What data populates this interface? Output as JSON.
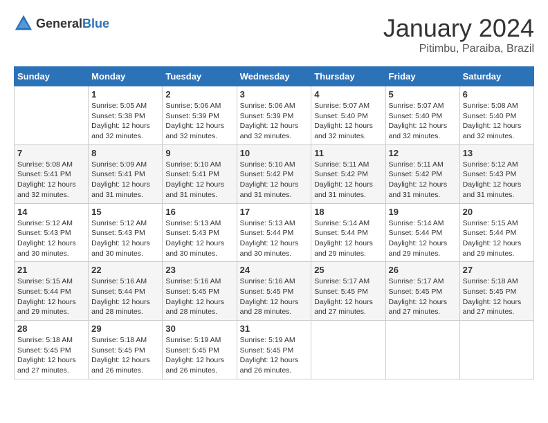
{
  "header": {
    "logo": {
      "general": "General",
      "blue": "Blue"
    },
    "title": "January 2024",
    "subtitle": "Pitimbu, Paraiba, Brazil"
  },
  "calendar": {
    "days_of_week": [
      "Sunday",
      "Monday",
      "Tuesday",
      "Wednesday",
      "Thursday",
      "Friday",
      "Saturday"
    ],
    "weeks": [
      [
        {
          "day": "",
          "info": ""
        },
        {
          "day": "1",
          "info": "Sunrise: 5:05 AM\nSunset: 5:38 PM\nDaylight: 12 hours\nand 32 minutes."
        },
        {
          "day": "2",
          "info": "Sunrise: 5:06 AM\nSunset: 5:39 PM\nDaylight: 12 hours\nand 32 minutes."
        },
        {
          "day": "3",
          "info": "Sunrise: 5:06 AM\nSunset: 5:39 PM\nDaylight: 12 hours\nand 32 minutes."
        },
        {
          "day": "4",
          "info": "Sunrise: 5:07 AM\nSunset: 5:40 PM\nDaylight: 12 hours\nand 32 minutes."
        },
        {
          "day": "5",
          "info": "Sunrise: 5:07 AM\nSunset: 5:40 PM\nDaylight: 12 hours\nand 32 minutes."
        },
        {
          "day": "6",
          "info": "Sunrise: 5:08 AM\nSunset: 5:40 PM\nDaylight: 12 hours\nand 32 minutes."
        }
      ],
      [
        {
          "day": "7",
          "info": "Sunrise: 5:08 AM\nSunset: 5:41 PM\nDaylight: 12 hours\nand 32 minutes."
        },
        {
          "day": "8",
          "info": "Sunrise: 5:09 AM\nSunset: 5:41 PM\nDaylight: 12 hours\nand 31 minutes."
        },
        {
          "day": "9",
          "info": "Sunrise: 5:10 AM\nSunset: 5:41 PM\nDaylight: 12 hours\nand 31 minutes."
        },
        {
          "day": "10",
          "info": "Sunrise: 5:10 AM\nSunset: 5:42 PM\nDaylight: 12 hours\nand 31 minutes."
        },
        {
          "day": "11",
          "info": "Sunrise: 5:11 AM\nSunset: 5:42 PM\nDaylight: 12 hours\nand 31 minutes."
        },
        {
          "day": "12",
          "info": "Sunrise: 5:11 AM\nSunset: 5:42 PM\nDaylight: 12 hours\nand 31 minutes."
        },
        {
          "day": "13",
          "info": "Sunrise: 5:12 AM\nSunset: 5:43 PM\nDaylight: 12 hours\nand 31 minutes."
        }
      ],
      [
        {
          "day": "14",
          "info": "Sunrise: 5:12 AM\nSunset: 5:43 PM\nDaylight: 12 hours\nand 30 minutes."
        },
        {
          "day": "15",
          "info": "Sunrise: 5:12 AM\nSunset: 5:43 PM\nDaylight: 12 hours\nand 30 minutes."
        },
        {
          "day": "16",
          "info": "Sunrise: 5:13 AM\nSunset: 5:43 PM\nDaylight: 12 hours\nand 30 minutes."
        },
        {
          "day": "17",
          "info": "Sunrise: 5:13 AM\nSunset: 5:44 PM\nDaylight: 12 hours\nand 30 minutes."
        },
        {
          "day": "18",
          "info": "Sunrise: 5:14 AM\nSunset: 5:44 PM\nDaylight: 12 hours\nand 29 minutes."
        },
        {
          "day": "19",
          "info": "Sunrise: 5:14 AM\nSunset: 5:44 PM\nDaylight: 12 hours\nand 29 minutes."
        },
        {
          "day": "20",
          "info": "Sunrise: 5:15 AM\nSunset: 5:44 PM\nDaylight: 12 hours\nand 29 minutes."
        }
      ],
      [
        {
          "day": "21",
          "info": "Sunrise: 5:15 AM\nSunset: 5:44 PM\nDaylight: 12 hours\nand 29 minutes."
        },
        {
          "day": "22",
          "info": "Sunrise: 5:16 AM\nSunset: 5:44 PM\nDaylight: 12 hours\nand 28 minutes."
        },
        {
          "day": "23",
          "info": "Sunrise: 5:16 AM\nSunset: 5:45 PM\nDaylight: 12 hours\nand 28 minutes."
        },
        {
          "day": "24",
          "info": "Sunrise: 5:16 AM\nSunset: 5:45 PM\nDaylight: 12 hours\nand 28 minutes."
        },
        {
          "day": "25",
          "info": "Sunrise: 5:17 AM\nSunset: 5:45 PM\nDaylight: 12 hours\nand 27 minutes."
        },
        {
          "day": "26",
          "info": "Sunrise: 5:17 AM\nSunset: 5:45 PM\nDaylight: 12 hours\nand 27 minutes."
        },
        {
          "day": "27",
          "info": "Sunrise: 5:18 AM\nSunset: 5:45 PM\nDaylight: 12 hours\nand 27 minutes."
        }
      ],
      [
        {
          "day": "28",
          "info": "Sunrise: 5:18 AM\nSunset: 5:45 PM\nDaylight: 12 hours\nand 27 minutes."
        },
        {
          "day": "29",
          "info": "Sunrise: 5:18 AM\nSunset: 5:45 PM\nDaylight: 12 hours\nand 26 minutes."
        },
        {
          "day": "30",
          "info": "Sunrise: 5:19 AM\nSunset: 5:45 PM\nDaylight: 12 hours\nand 26 minutes."
        },
        {
          "day": "31",
          "info": "Sunrise: 5:19 AM\nSunset: 5:45 PM\nDaylight: 12 hours\nand 26 minutes."
        },
        {
          "day": "",
          "info": ""
        },
        {
          "day": "",
          "info": ""
        },
        {
          "day": "",
          "info": ""
        }
      ]
    ]
  }
}
